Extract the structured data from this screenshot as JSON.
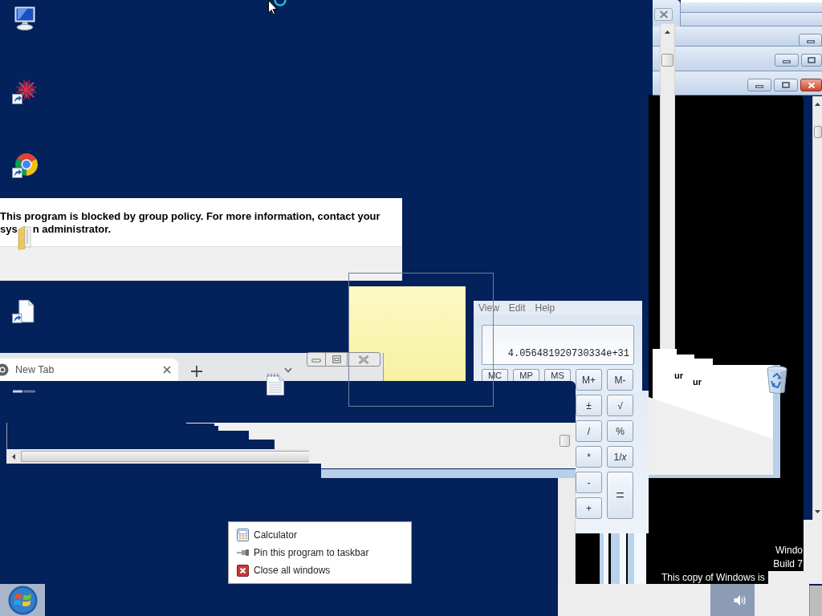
{
  "blocked_dialog": {
    "message": "This program is blocked by group policy. For more information, contact your",
    "message_continued_start": "sys",
    "message_continued_end": "n administrator."
  },
  "browser": {
    "tabs": [
      {
        "title": "New Tab",
        "selected": true
      }
    ]
  },
  "calculator": {
    "menu": [
      "View",
      "Edit",
      "Help"
    ],
    "display": "4.056481920730334e+31",
    "memory_keys": [
      "MC",
      "MP",
      "MS",
      "M+",
      "M-"
    ],
    "keys": [
      {
        "label": "±",
        "kind": "key"
      },
      {
        "label": "√",
        "kind": "key"
      },
      {
        "label": "/",
        "kind": "key"
      },
      {
        "label": "%",
        "kind": "key"
      },
      {
        "label": "*",
        "kind": "key"
      },
      {
        "label": "1/*x*",
        "kind": "key"
      },
      {
        "label": "-",
        "kind": "key"
      },
      {
        "label": "=",
        "kind": "tall"
      },
      {
        "label": "+",
        "kind": "key"
      }
    ]
  },
  "glitch_fragments": [
    "ur",
    "ur"
  ],
  "jump_list": {
    "items": [
      {
        "label": "Calculator",
        "kind": "app"
      },
      {
        "label": "Pin this program to taskbar",
        "kind": "pin"
      },
      {
        "label": "Close all windows",
        "kind": "close"
      }
    ]
  },
  "activation_notice": {
    "line_1": "Windo",
    "line_2": "Build 7",
    "line_3": "This copy of Windows is"
  }
}
